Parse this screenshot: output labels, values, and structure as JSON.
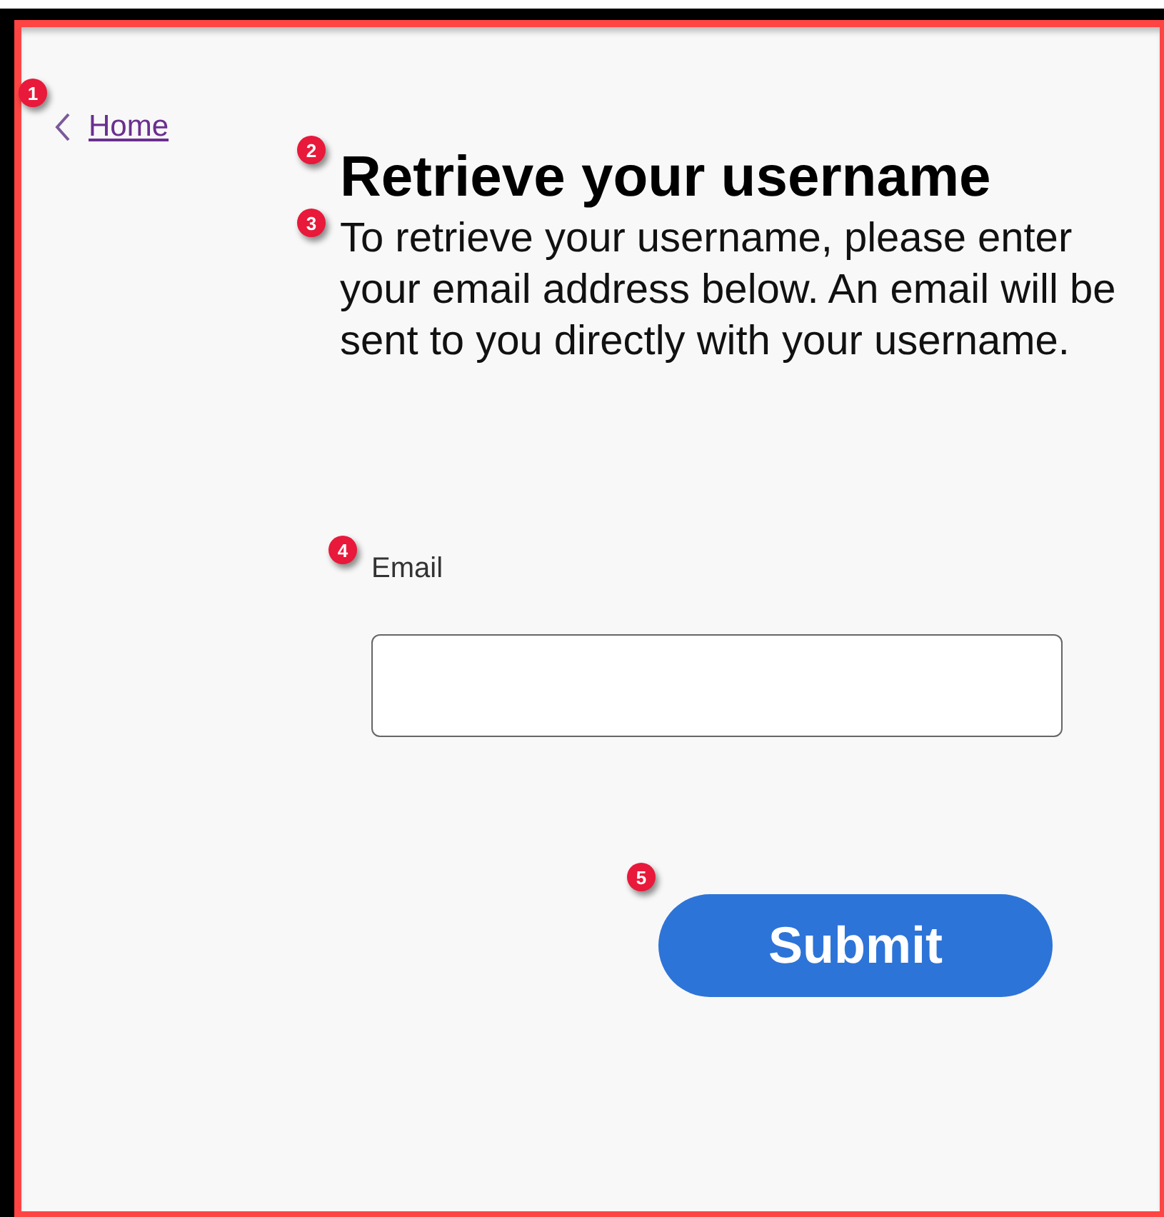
{
  "back_link": {
    "label": "Home",
    "marker": "1"
  },
  "heading": {
    "text": "Retrieve your username",
    "marker": "2"
  },
  "description": {
    "text": "To retrieve your username, please enter your email address below. An email will be sent to you directly with your username.",
    "marker": "3"
  },
  "email_field": {
    "label": "Email",
    "marker": "4"
  },
  "submit_button": {
    "label": "Submit",
    "marker": "5"
  }
}
